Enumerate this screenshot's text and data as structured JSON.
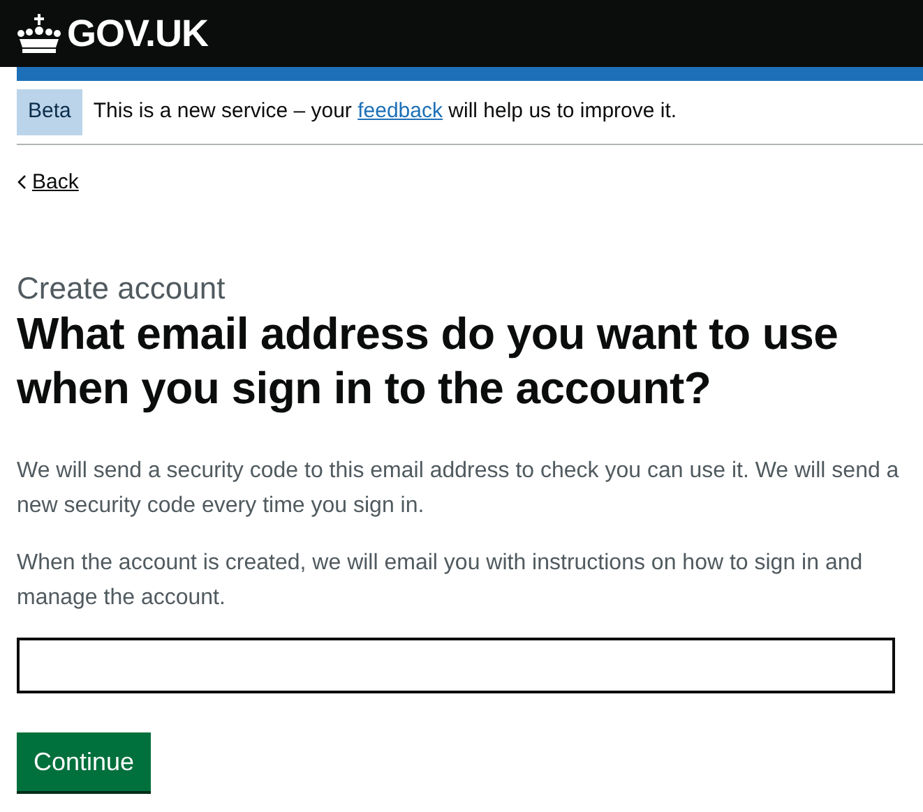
{
  "header": {
    "logo_text": "GOV.UK"
  },
  "phase_banner": {
    "tag": "Beta",
    "text_before": "This is a new service – your ",
    "link": "feedback",
    "text_after": " will help us to improve it."
  },
  "back_link": {
    "label": "Back"
  },
  "caption": "Create account",
  "heading": "What email address do you want to use when you sign in to the account?",
  "paragraphs": [
    "We will send a security code to this email address to check you can use it. We will send a new security code every time you sign in.",
    "When the account is created, we will email you with instructions on how to sign in and manage the account."
  ],
  "email_field": {
    "kind": "text"
  },
  "buttons": [
    {
      "label": "Continue"
    }
  ]
}
